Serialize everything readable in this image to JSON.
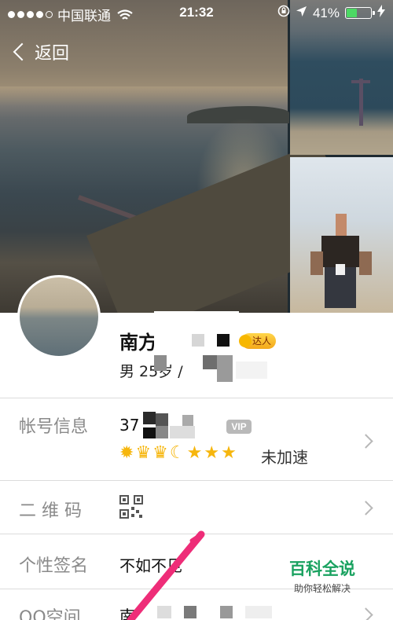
{
  "status_bar": {
    "carrier": "中国联通",
    "time": "21:32",
    "battery_percent": "41%",
    "battery_level": 0.41,
    "icons": [
      "signal-dots-icon",
      "wifi-icon",
      "rotation-lock-icon",
      "location-arrow-icon",
      "battery-icon",
      "charging-bolt-icon"
    ]
  },
  "header": {
    "back_label": "返回"
  },
  "profile": {
    "name": "南方",
    "badge": "达人",
    "sub_info": "男  25岁  /"
  },
  "rows": [
    {
      "label": "帐号信息",
      "value": "37",
      "vip": "VIP",
      "level_icons": [
        "sun-icon",
        "crown-icon",
        "crown-icon",
        "moon-icon",
        "star-icon",
        "star-icon",
        "star-icon"
      ],
      "speed_status": "未加速"
    },
    {
      "label": "二 维 码",
      "icon": "qr-code-icon"
    },
    {
      "label": "个性签名",
      "value": "不如不见"
    },
    {
      "label": "QQ空间",
      "value": "南"
    }
  ],
  "watermark": {
    "title": "百科全说",
    "subtitle": "助你轻松解决"
  },
  "colors": {
    "accent_green": "#1aa260",
    "annotation_arrow": "#ee2d78",
    "badge_gold": "#f4a81a",
    "battery_green": "#4cd964"
  }
}
